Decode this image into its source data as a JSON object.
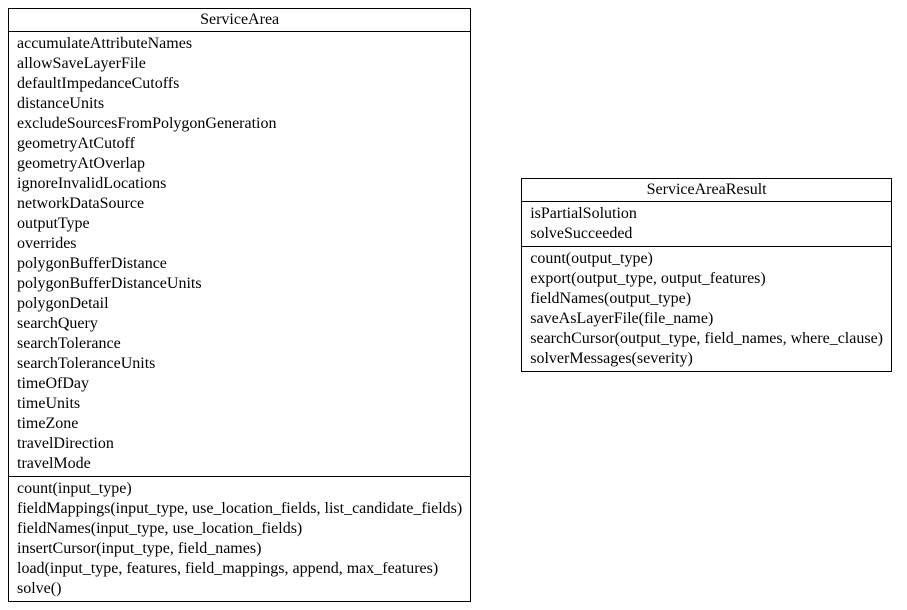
{
  "left": {
    "title": "ServiceArea",
    "attributes": [
      "accumulateAttributeNames",
      "allowSaveLayerFile",
      "defaultImpedanceCutoffs",
      "distanceUnits",
      "excludeSourcesFromPolygonGeneration",
      "geometryAtCutoff",
      "geometryAtOverlap",
      "ignoreInvalidLocations",
      "networkDataSource",
      "outputType",
      "overrides",
      "polygonBufferDistance",
      "polygonBufferDistanceUnits",
      "polygonDetail",
      "searchQuery",
      "searchTolerance",
      "searchToleranceUnits",
      "timeOfDay",
      "timeUnits",
      "timeZone",
      "travelDirection",
      "travelMode"
    ],
    "methods": [
      "count(input_type)",
      "fieldMappings(input_type, use_location_fields, list_candidate_fields)",
      "fieldNames(input_type, use_location_fields)",
      "insertCursor(input_type, field_names)",
      "load(input_type, features, field_mappings, append, max_features)",
      "solve()"
    ]
  },
  "right": {
    "title": "ServiceAreaResult",
    "attributes": [
      "isPartialSolution",
      "solveSucceeded"
    ],
    "methods": [
      "count(output_type)",
      "export(output_type, output_features)",
      "fieldNames(output_type)",
      "saveAsLayerFile(file_name)",
      "searchCursor(output_type, field_names, where_clause)",
      "solverMessages(severity)"
    ]
  }
}
